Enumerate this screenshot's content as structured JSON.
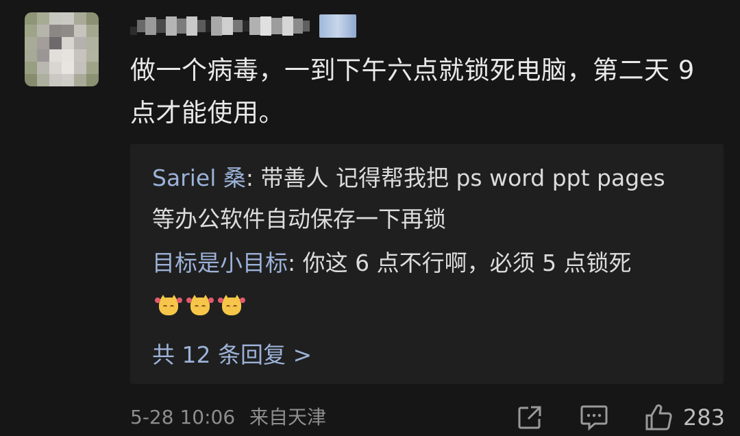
{
  "comment": {
    "username": "",
    "text": "做一个病毒，一到下午六点就锁死电脑，第二天 9 点才能使用。",
    "replies": [
      {
        "author": "Sariel 桑",
        "text": "带善人 记得帮我把 ps word ppt pages 等办公软件自动保存一下再锁"
      },
      {
        "author": "目标是小目标",
        "text": "你这 6 点不行啊，必须 5 点锁死"
      }
    ],
    "reply_count_label": "共 12 条回复 >",
    "date": "5-28 10:06",
    "location": "来自天津",
    "like_count": "283"
  },
  "icons": {
    "share": "share-icon",
    "comment": "comment-icon",
    "like": "thumbs-up-icon"
  },
  "colors": {
    "background": "#161616",
    "reply_background": "#1f1f1f",
    "link": "#9cb2d8",
    "meta": "#8e8e8e"
  }
}
